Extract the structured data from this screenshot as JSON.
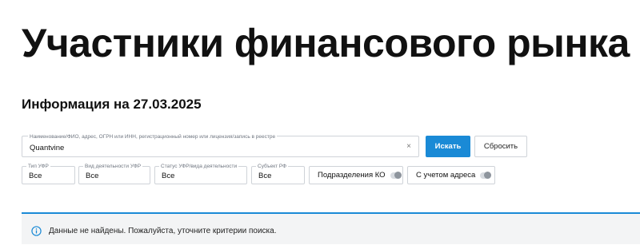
{
  "page": {
    "title": "Участники финансового рынка",
    "info_date": "Информация на 27.03.2025"
  },
  "search": {
    "label": "Наименование/ФИО, адрес, ОГРН или ИНН, регистрационный номер или лицензия/запись в реестре",
    "value": "Quantvine",
    "clear_icon": "×",
    "search_button": "Искать",
    "reset_button": "Сбросить"
  },
  "filters": [
    {
      "label": "Тип УФР",
      "value": "Все"
    },
    {
      "label": "Вид деятельности УФР",
      "value": "Все"
    },
    {
      "label": "Статус УФР/вида деятельности",
      "value": "Все"
    },
    {
      "label": "Субъект РФ",
      "value": "Все"
    }
  ],
  "toggles": [
    {
      "label": "Подразделения КО",
      "on": false
    },
    {
      "label": "С учетом адреса",
      "on": false
    }
  ],
  "notice": {
    "icon": "info-icon",
    "message": "Данные не найдены. Пожалуйста, уточните критерии поиска."
  },
  "colors": {
    "accent": "#1a8ad6",
    "border": "#cfd3d8",
    "notice_bg": "#f3f4f5"
  }
}
